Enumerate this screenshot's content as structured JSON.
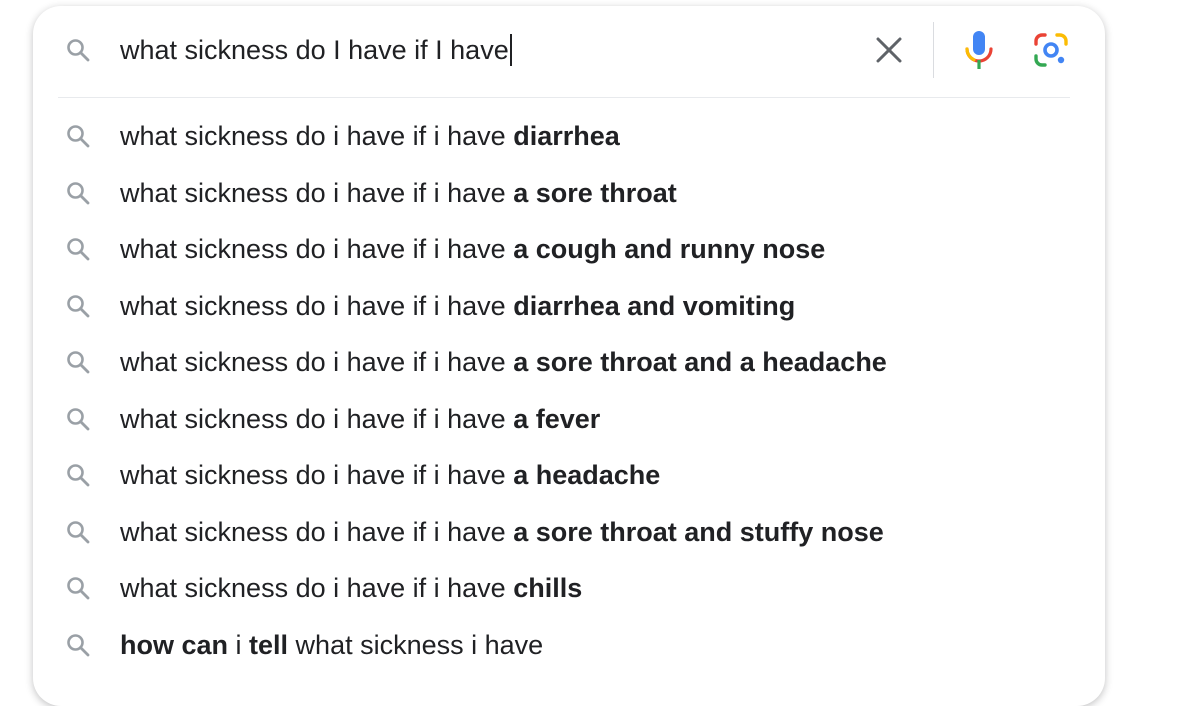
{
  "search": {
    "query": "what sickness do I have if I have",
    "clear_icon": "close-icon",
    "mic_icon": "microphone-icon",
    "lens_icon": "lens-camera-icon",
    "colors": {
      "mic_blue": "#4285f4",
      "mic_red": "#ea4335",
      "mic_yellow": "#fbbc04",
      "mic_green": "#34a853",
      "icon_gray": "#9aa0a6",
      "text": "#202124"
    }
  },
  "suggestions": [
    {
      "parts": [
        {
          "text": "what sickness do i have if i have ",
          "bold": false
        },
        {
          "text": "diarrhea",
          "bold": true
        }
      ]
    },
    {
      "parts": [
        {
          "text": "what sickness do i have if i have ",
          "bold": false
        },
        {
          "text": "a sore throat",
          "bold": true
        }
      ]
    },
    {
      "parts": [
        {
          "text": "what sickness do i have if i have ",
          "bold": false
        },
        {
          "text": "a cough and runny nose",
          "bold": true
        }
      ]
    },
    {
      "parts": [
        {
          "text": "what sickness do i have if i have ",
          "bold": false
        },
        {
          "text": "diarrhea and vomiting",
          "bold": true
        }
      ]
    },
    {
      "parts": [
        {
          "text": "what sickness do i have if i have ",
          "bold": false
        },
        {
          "text": "a sore throat and a headache",
          "bold": true
        }
      ]
    },
    {
      "parts": [
        {
          "text": "what sickness do i have if i have ",
          "bold": false
        },
        {
          "text": "a fever",
          "bold": true
        }
      ]
    },
    {
      "parts": [
        {
          "text": "what sickness do i have if i have ",
          "bold": false
        },
        {
          "text": "a headache",
          "bold": true
        }
      ]
    },
    {
      "parts": [
        {
          "text": "what sickness do i have if i have ",
          "bold": false
        },
        {
          "text": "a sore throat and stuffy nose",
          "bold": true
        }
      ]
    },
    {
      "parts": [
        {
          "text": "what sickness do i have if i have ",
          "bold": false
        },
        {
          "text": "chills",
          "bold": true
        }
      ]
    },
    {
      "parts": [
        {
          "text": "how can",
          "bold": true
        },
        {
          "text": " i ",
          "bold": false
        },
        {
          "text": "tell",
          "bold": true
        },
        {
          "text": " what sickness i have",
          "bold": false
        }
      ]
    }
  ]
}
